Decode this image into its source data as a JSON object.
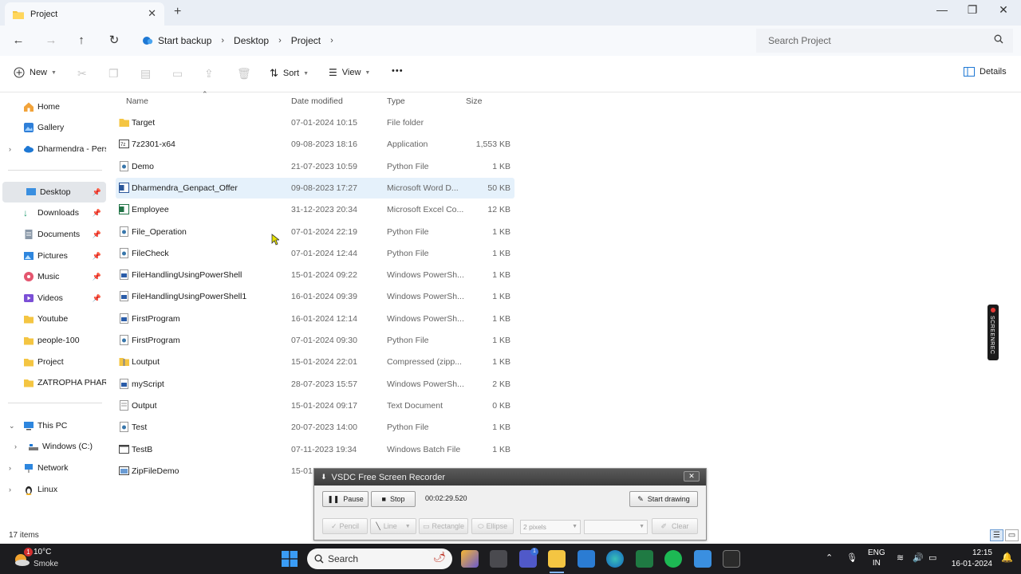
{
  "window": {
    "tab_title": "Project",
    "new_tab": "+",
    "minimize": "—",
    "maximize": "❐",
    "close": "✕"
  },
  "address": {
    "crumbs": [
      "Start backup",
      "Desktop",
      "Project"
    ],
    "search_placeholder": "Search Project"
  },
  "toolbar": {
    "new_label": "New",
    "sort_label": "Sort",
    "view_label": "View",
    "more_label": "•••",
    "details_label": "Details"
  },
  "sidebar": {
    "items": [
      {
        "label": "Home"
      },
      {
        "label": "Gallery"
      },
      {
        "label": "Dharmendra - Perso"
      },
      {
        "label": "Desktop"
      },
      {
        "label": "Downloads"
      },
      {
        "label": "Documents"
      },
      {
        "label": "Pictures"
      },
      {
        "label": "Music"
      },
      {
        "label": "Videos"
      },
      {
        "label": "Youtube"
      },
      {
        "label": "people-100"
      },
      {
        "label": "Project"
      },
      {
        "label": "ZATROPHA PHARM"
      },
      {
        "label": "This PC"
      },
      {
        "label": "Windows (C:)"
      },
      {
        "label": "Network"
      },
      {
        "label": "Linux"
      }
    ]
  },
  "columns": {
    "name": "Name",
    "date": "Date modified",
    "type": "Type",
    "size": "Size"
  },
  "files": [
    {
      "name": "Target",
      "date": "07-01-2024 10:15",
      "type": "File folder",
      "size": ""
    },
    {
      "name": "7z2301-x64",
      "date": "09-08-2023 18:16",
      "type": "Application",
      "size": "1,553 KB"
    },
    {
      "name": "Demo",
      "date": "21-07-2023 10:59",
      "type": "Python File",
      "size": "1 KB"
    },
    {
      "name": "Dharmendra_Genpact_Offer",
      "date": "09-08-2023 17:27",
      "type": "Microsoft Word D...",
      "size": "50 KB"
    },
    {
      "name": "Employee",
      "date": "31-12-2023 20:34",
      "type": "Microsoft Excel Co...",
      "size": "12 KB"
    },
    {
      "name": "File_Operation",
      "date": "07-01-2024 22:19",
      "type": "Python File",
      "size": "1 KB"
    },
    {
      "name": "FileCheck",
      "date": "07-01-2024 12:44",
      "type": "Python File",
      "size": "1 KB"
    },
    {
      "name": "FileHandlingUsingPowerShell",
      "date": "15-01-2024 09:22",
      "type": "Windows PowerSh...",
      "size": "1 KB"
    },
    {
      "name": "FileHandlingUsingPowerShell1",
      "date": "16-01-2024 09:39",
      "type": "Windows PowerSh...",
      "size": "1 KB"
    },
    {
      "name": "FirstProgram",
      "date": "16-01-2024 12:14",
      "type": "Windows PowerSh...",
      "size": "1 KB"
    },
    {
      "name": "FirstProgram",
      "date": "07-01-2024 09:30",
      "type": "Python File",
      "size": "1 KB"
    },
    {
      "name": "Loutput",
      "date": "15-01-2024 22:01",
      "type": "Compressed (zipp...",
      "size": "1 KB"
    },
    {
      "name": "myScript",
      "date": "28-07-2023 15:57",
      "type": "Windows PowerSh...",
      "size": "2 KB"
    },
    {
      "name": "Output",
      "date": "15-01-2024 09:17",
      "type": "Text Document",
      "size": "0 KB"
    },
    {
      "name": "Test",
      "date": "20-07-2023 14:00",
      "type": "Python File",
      "size": "1 KB"
    },
    {
      "name": "TestB",
      "date": "07-11-2023 19:34",
      "type": "Windows Batch File",
      "size": "1 KB"
    },
    {
      "name": "ZipFileDemo",
      "date": "15-01",
      "type": "",
      "size": ""
    }
  ],
  "status": {
    "item_count": "17 items"
  },
  "recorder": {
    "title": "VSDC Free Screen Recorder",
    "pause_label": "Pause",
    "stop_label": "Stop",
    "elapsed": "00:02:29.520",
    "start_drawing_label": "Start drawing",
    "pencil_label": "Pencil",
    "line_label": "Line",
    "rectangle_label": "Rectangle",
    "ellipse_label": "Ellipse",
    "pixels_value": "2 pixels",
    "clear_label": "Clear"
  },
  "badge": {
    "text": "SCREENREC"
  },
  "taskbar": {
    "temperature": "10°C",
    "condition": "Smoke",
    "weather_alert": "1",
    "search_label": "Search",
    "teams_badge": "1",
    "lang_line1": "ENG",
    "lang_line2": "IN",
    "time": "12:15",
    "date": "16-01-2024"
  }
}
